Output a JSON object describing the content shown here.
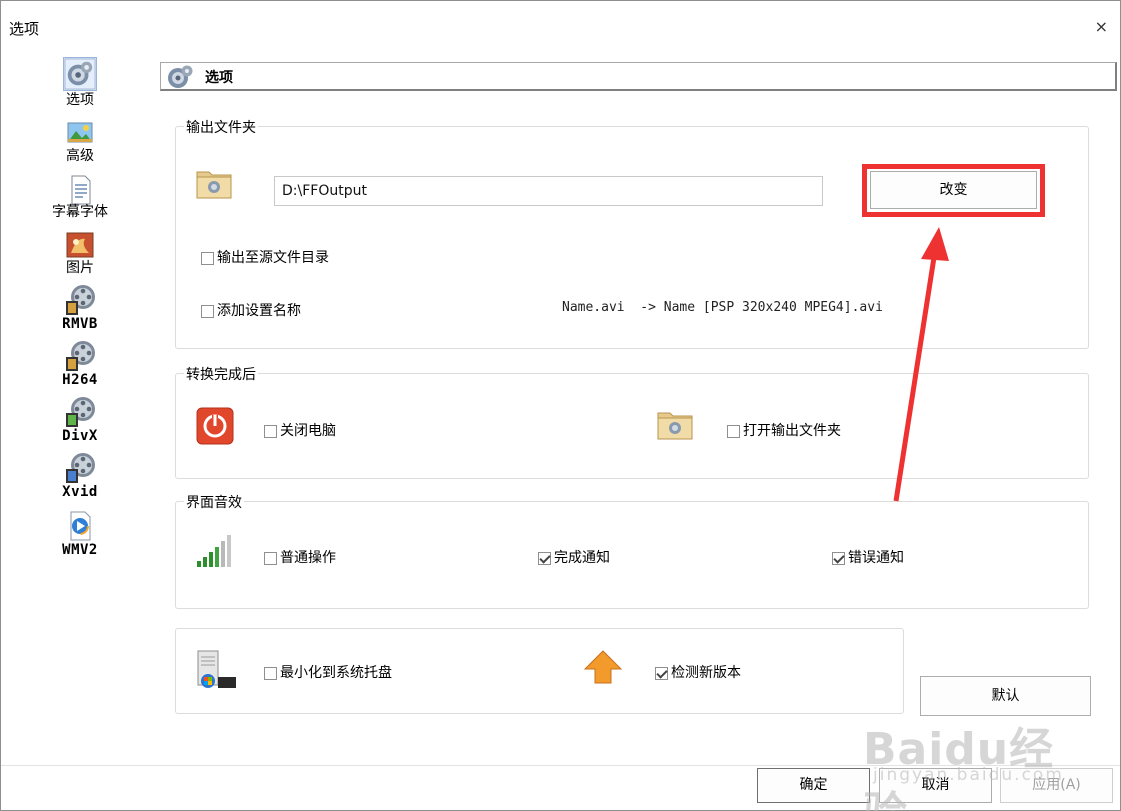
{
  "window": {
    "title": "选项",
    "close_glyph": "×"
  },
  "sidebar": {
    "items": [
      {
        "label": "选项",
        "icon": "options-icon",
        "selected": true
      },
      {
        "label": "高级",
        "icon": "picture-advanced-icon"
      },
      {
        "label": "字幕字体",
        "icon": "subtitle-document-icon"
      },
      {
        "label": "图片",
        "icon": "image-icon"
      },
      {
        "label": "RMVB",
        "icon": "film-reel-icon"
      },
      {
        "label": "H264",
        "icon": "film-reel-icon"
      },
      {
        "label": "DivX",
        "icon": "film-reel-icon"
      },
      {
        "label": "Xvid",
        "icon": "film-reel-icon"
      },
      {
        "label": "WMV2",
        "icon": "media-player-icon"
      }
    ]
  },
  "header": {
    "title": "选项"
  },
  "output_folder": {
    "group_title": "输出文件夹",
    "path": "D:\\FFOutput",
    "change_label": "改变",
    "output_to_source_label": "输出至源文件目录",
    "output_to_source_checked": false,
    "add_setting_name_label": "添加设置名称",
    "add_setting_name_checked": false,
    "example": "Name.avi  -> Name [PSP 320x240 MPEG4].avi"
  },
  "after_convert": {
    "group_title": "转换完成后",
    "shutdown_label": "关闭电脑",
    "shutdown_checked": false,
    "open_folder_label": "打开输出文件夹",
    "open_folder_checked": false
  },
  "sound": {
    "group_title": "界面音效",
    "normal_label": "普通操作",
    "normal_checked": false,
    "complete_label": "完成通知",
    "complete_checked": true,
    "error_label": "错误通知",
    "error_checked": true
  },
  "misc": {
    "minimize_tray_label": "最小化到系统托盘",
    "minimize_tray_checked": false,
    "check_update_label": "检测新版本",
    "check_update_checked": true
  },
  "buttons": {
    "default": "默认",
    "ok": "确定",
    "cancel": "取消",
    "apply": "应用(A)"
  },
  "watermark": {
    "line1": "Baidu经验",
    "line2": "jingyan.baidu.com"
  },
  "colors": {
    "highlight": "#ee3131",
    "arrow": "#ee3131"
  }
}
